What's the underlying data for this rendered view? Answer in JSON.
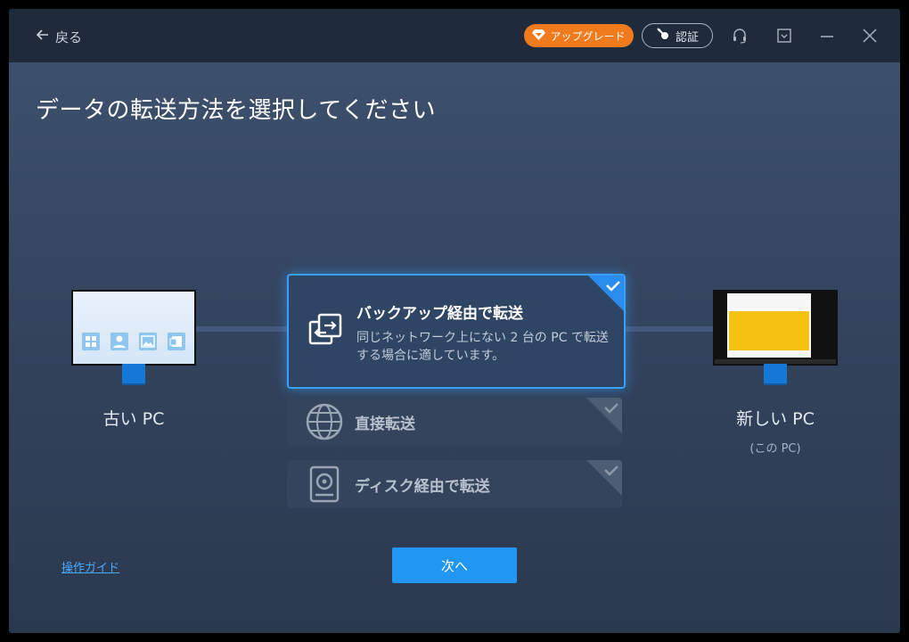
{
  "header": {
    "back_label": "戻る",
    "upgrade_label": "アップグレード",
    "auth_label": "認証"
  },
  "page": {
    "title": "データの転送方法を選択してください"
  },
  "source_pc": {
    "label": "古い PC"
  },
  "target_pc": {
    "label": "新しい PC",
    "sub": "(この PC)"
  },
  "methods": [
    {
      "title": "バックアップ経由で転送",
      "description": "同じネットワーク上にない 2 台の PC で転送する場合に適しています。",
      "selected": true,
      "icon": "backup-transfer-icon"
    },
    {
      "title": "直接転送",
      "selected": false,
      "icon": "globe-icon"
    },
    {
      "title": "ディスク経由で転送",
      "selected": false,
      "icon": "disk-icon"
    }
  ],
  "footer": {
    "guide_label": "操作ガイド",
    "next_label": "次へ"
  },
  "colors": {
    "accent": "#2196f3",
    "upgrade": "#f07b1c",
    "selected_border": "#39a0ff"
  }
}
